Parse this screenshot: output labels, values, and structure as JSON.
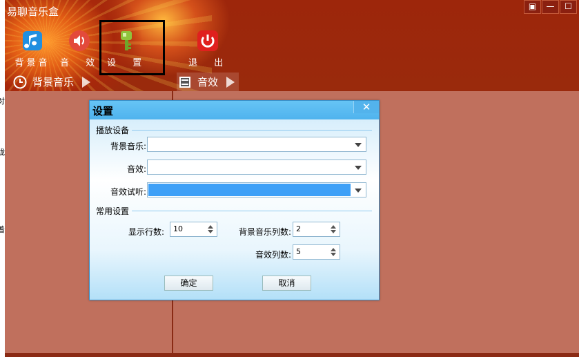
{
  "app": {
    "title": "易聊音乐盒"
  },
  "window_controls": [
    "▣",
    "—",
    "☐"
  ],
  "left_strip": [
    "对",
    "胧",
    "着"
  ],
  "toolbar": [
    {
      "label": "背景音",
      "icon": "music-note-icon"
    },
    {
      "label": "音 效",
      "icon": "speaker-icon"
    },
    {
      "label": "设 置",
      "icon": "key-icon"
    },
    {
      "label": "退 出",
      "icon": "power-icon"
    }
  ],
  "tabs": [
    {
      "label": "背景音乐",
      "icon": "clock-icon"
    },
    {
      "label": "音效",
      "icon": "list-icon"
    }
  ],
  "dialog": {
    "title": "设置",
    "close": "✕",
    "sections": {
      "playback": "播放设备",
      "common": "常用设置"
    },
    "fields": {
      "bg_music": {
        "label": "背景音乐:",
        "value": ""
      },
      "effect": {
        "label": "音效:",
        "value": ""
      },
      "effect_preview": {
        "label": "音效试听:",
        "value": ""
      },
      "rows": {
        "label": "显示行数:",
        "value": "10"
      },
      "bg_cols": {
        "label": "背景音乐列数:",
        "value": "2"
      },
      "effect_cols": {
        "label": "音效列数:",
        "value": "5"
      }
    },
    "buttons": {
      "ok": "确定",
      "cancel": "取消"
    }
  },
  "colors": {
    "accent": "#3ea0f7",
    "dialog_header": "#55b8f0",
    "app_bg": "#c0705d",
    "top_bg": "#9d260b"
  }
}
